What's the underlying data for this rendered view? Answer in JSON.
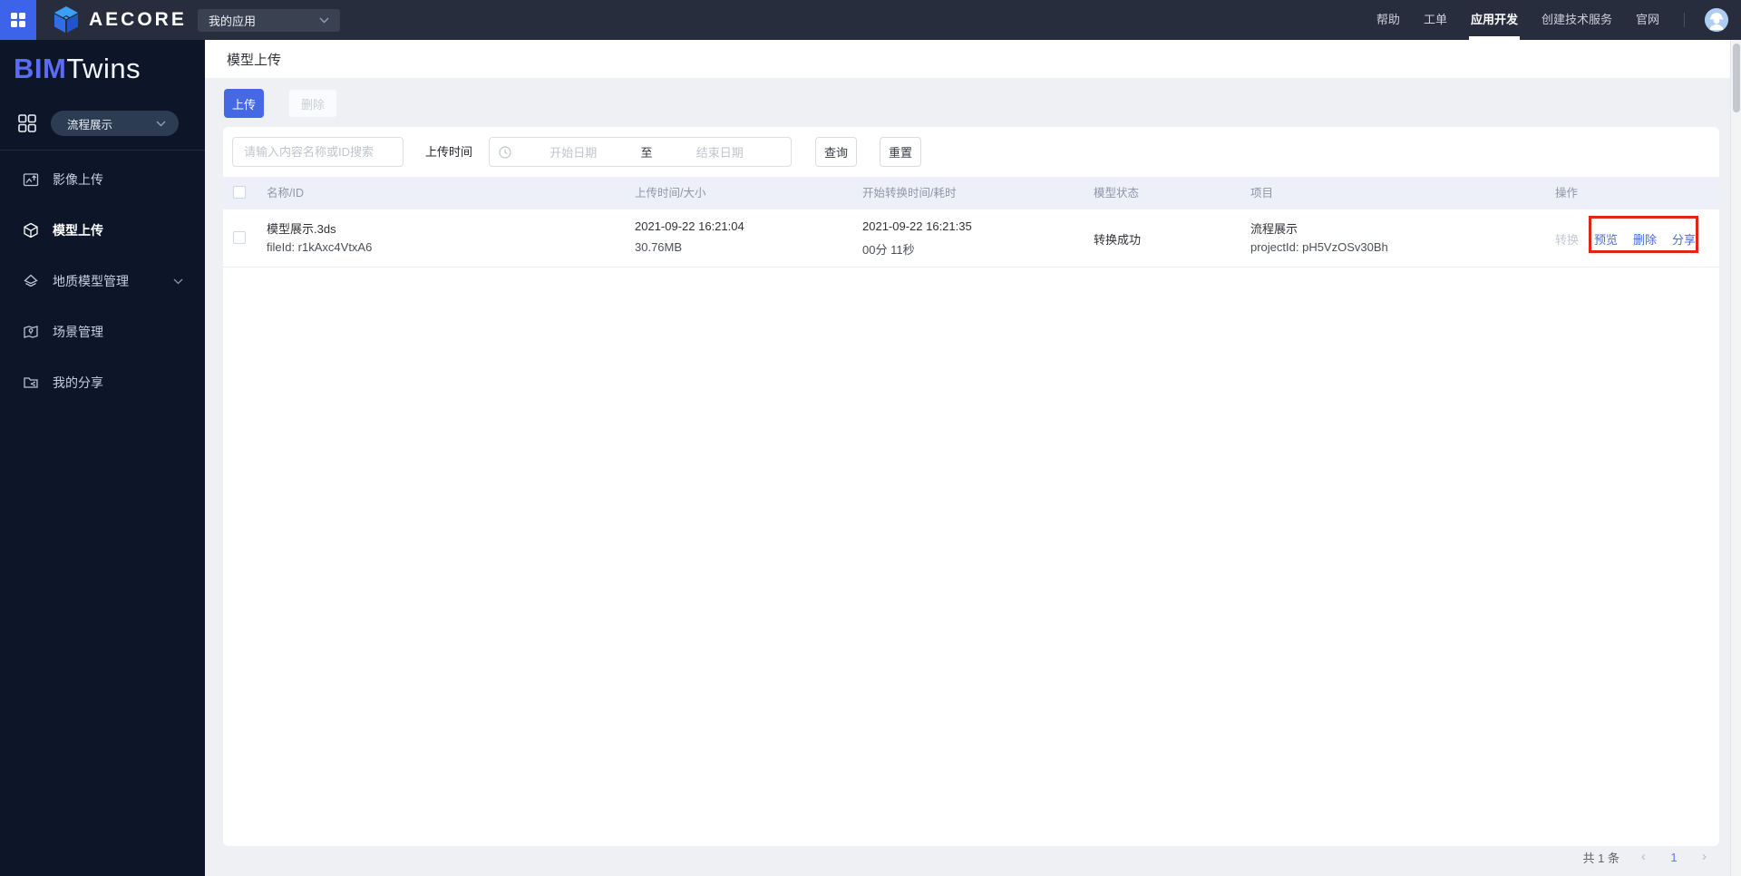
{
  "topbar": {
    "brand": "AECORE",
    "app_select_value": "我的应用",
    "nav": [
      {
        "label": "帮助",
        "active": false
      },
      {
        "label": "工单",
        "active": false
      },
      {
        "label": "应用开发",
        "active": true
      },
      {
        "label": "创建技术服务",
        "active": false
      },
      {
        "label": "官网",
        "active": false
      }
    ]
  },
  "sidebar": {
    "logo_bim": "BIM",
    "logo_twins": "Twins",
    "app_switcher_value": "流程展示",
    "menu": [
      {
        "label": "影像上传",
        "icon": "image-upload-icon",
        "active": false,
        "expandable": false
      },
      {
        "label": "模型上传",
        "icon": "model-upload-icon",
        "active": true,
        "expandable": false
      },
      {
        "label": "地质模型管理",
        "icon": "geology-model-icon",
        "active": false,
        "expandable": true
      },
      {
        "label": "场景管理",
        "icon": "scene-manage-icon",
        "active": false,
        "expandable": false
      },
      {
        "label": "我的分享",
        "icon": "my-share-icon",
        "active": false,
        "expandable": false
      }
    ]
  },
  "page": {
    "title": "模型上传",
    "toolbar": {
      "upload": "上传",
      "delete": "删除"
    },
    "filters": {
      "search_placeholder": "请输入内容名称或ID搜索",
      "time_label": "上传时间",
      "start_placeholder": "开始日期",
      "to_label": "至",
      "end_placeholder": "结束日期",
      "query": "查询",
      "reset": "重置"
    },
    "table": {
      "columns": [
        "名称/ID",
        "上传时间/大小",
        "开始转换时间/耗时",
        "模型状态",
        "项目",
        "操作"
      ],
      "rows": [
        {
          "name": "模型展示.3ds",
          "file_id": "fileId: r1kAxc4VtxA6",
          "upload_time": "2021-09-22 16:21:04",
          "size": "30.76MB",
          "convert_start": "2021-09-22 16:21:35",
          "duration": "00分 11秒",
          "status": "转换成功",
          "project": "流程展示",
          "project_id": "projectId: pH5VzOSv30Bh",
          "actions": {
            "convert": "转换",
            "preview": "预览",
            "delete": "删除",
            "share": "分享"
          }
        }
      ]
    },
    "pagination": {
      "total": "共 1 条",
      "page": "1"
    }
  },
  "annotation": {
    "type": "highlight-box",
    "target": "row-actions 预览/删除/分享",
    "color": "#e02616"
  },
  "colors": {
    "primary_button": "#4569e2",
    "link_blue": "#4a6bdf",
    "annotation_red": "#e02616",
    "topbar_bg": "#272d3c",
    "sidebar_bg": "#0c1628",
    "logo_indigo": "#5c6cf2",
    "table_header_bg": "#edf0f9",
    "avatar_bg": "#aecdf2",
    "apps_button_bg": "#3d63e8"
  }
}
